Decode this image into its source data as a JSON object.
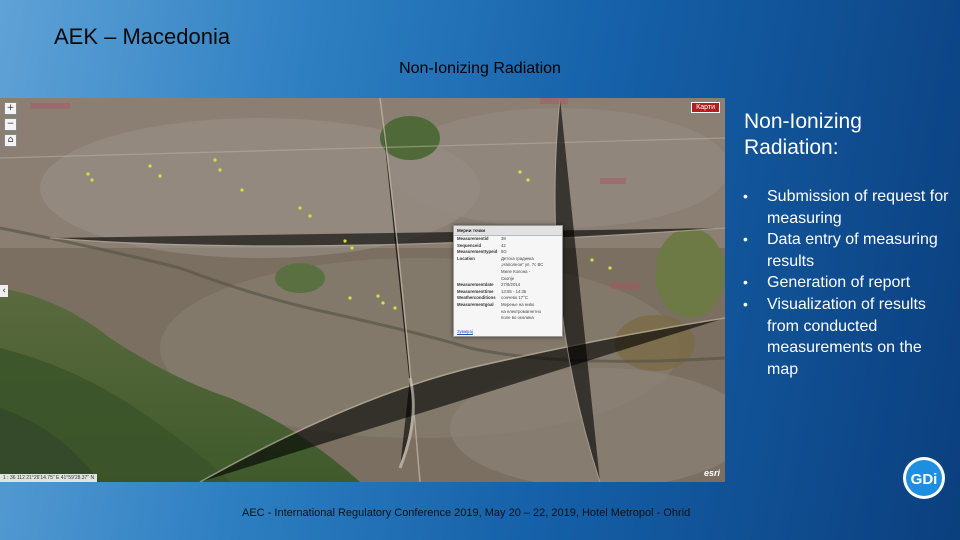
{
  "slide": {
    "title": "AEK – Macedonia",
    "map_heading": "Non-Ionizing Radiation",
    "footer": "AEC - International Regulatory Conference 2019, May 20 – 22, 2019, Hotel Metropol - Ohrid"
  },
  "map": {
    "zoom_in": "+",
    "zoom_out": "−",
    "basemap_label": "Карти",
    "side_arrow": "‹",
    "coordinates_text": "1 : 36 112  21°26'14.75\" E  41°59'28.37\" N",
    "attribution": "esri",
    "popup": {
      "title": "Мерни точки",
      "rows": [
        {
          "key": "Measurementid",
          "value": "38"
        },
        {
          "key": "Sequenceid",
          "value": "42"
        },
        {
          "key": "Measurementtypeid",
          "value": "5G"
        },
        {
          "key": "Location",
          "value": "Детска градинка"
        },
        {
          "key": "",
          "value": "„Наполеон“ ул. 7с ВС"
        },
        {
          "key": "",
          "value": "Миле Колона -"
        },
        {
          "key": "",
          "value": "Скопје"
        },
        {
          "key": "Measurementdate",
          "value": "27/8/2014"
        },
        {
          "key": "Measurementtime",
          "value": "13:55 - 14:35"
        },
        {
          "key": "Weatherconditions",
          "value": "сончево 17°C"
        },
        {
          "key": "Measurementgoal",
          "value": "Мерење на ниво"
        },
        {
          "key": "",
          "value": "на електромагнетно"
        },
        {
          "key": "",
          "value": "поле во околина"
        }
      ],
      "link": "Зумирај"
    }
  },
  "panel": {
    "title": "Non-Ionizing Radiation:",
    "bullets": [
      "Submission of request for measuring",
      "Data entry of measuring results",
      "Generation of report",
      "Visualization of results from conducted measurements on the map"
    ]
  },
  "logo": {
    "text": "GDi",
    "color": "#1e8fe0"
  },
  "colors": {
    "background_start": "#5fa2d6",
    "background_end": "#0b3f7e",
    "marker": "#c8e840"
  }
}
